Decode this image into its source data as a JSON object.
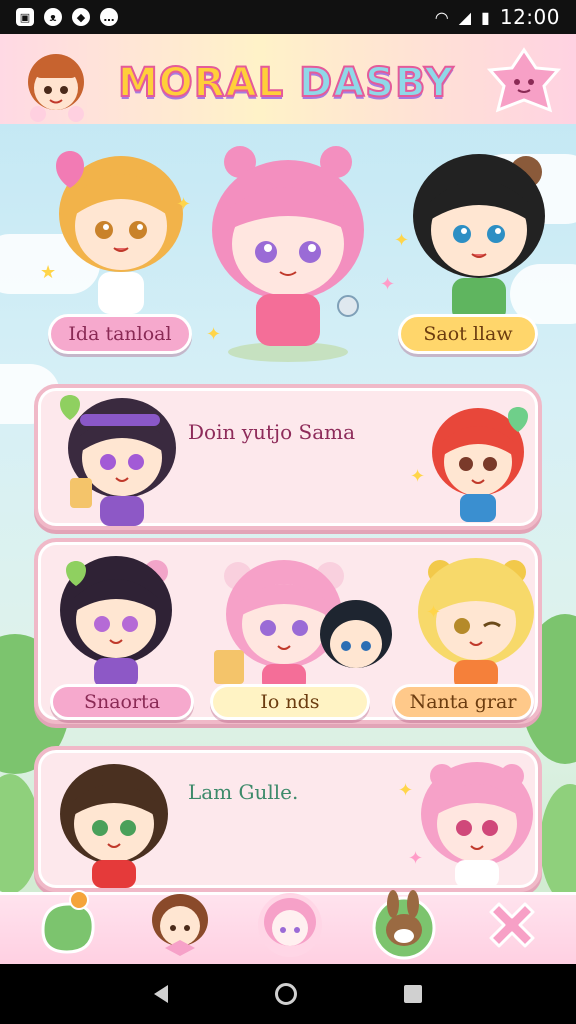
{
  "status_bar": {
    "time": "12:00",
    "left_icons": [
      "gallery-icon",
      "cat-icon",
      "shield-icon",
      "chat-icon"
    ],
    "right_icons": [
      "wifi-icon",
      "signal-icon",
      "battery-icon"
    ]
  },
  "header": {
    "title_part1": "MORAL",
    "title_part2": "DASBY",
    "menu_icon": "star-face-icon"
  },
  "featured": {
    "left_label": "Ida tanloal",
    "right_label": "Saot llaw"
  },
  "cards": [
    {
      "title": "Doin yutjo Sama"
    },
    {
      "labels": [
        "Snaorta",
        "Io nds",
        "Nanta grar"
      ]
    },
    {
      "title": "Lam Gulle."
    }
  ],
  "bottom_nav": [
    "leaf-icon",
    "girl-avatar-icon",
    "pink-avatar-icon",
    "bunny-icon",
    "close-icon"
  ],
  "colors": {
    "accent_pink": "#f6a9cd",
    "accent_yellow": "#ffd66b",
    "card_bg": "#fde8ec",
    "card_border": "#f0b9c8"
  }
}
